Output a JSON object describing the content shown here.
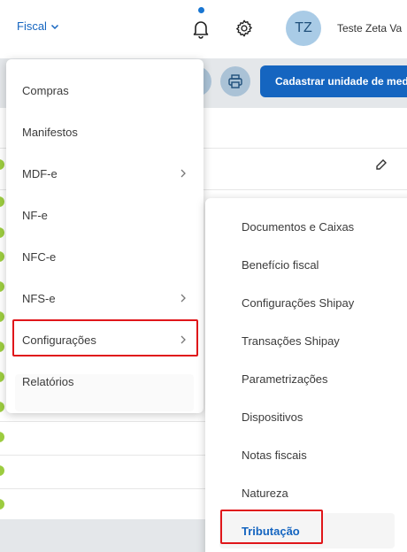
{
  "header": {
    "module_label": "Fiscal",
    "user_initials": "TZ",
    "user_name": "Teste Zeta Va"
  },
  "toolbar": {
    "primary_button_label": "Cadastrar unidade de med"
  },
  "menu": {
    "items": [
      {
        "label": "Compras",
        "has_submenu": false
      },
      {
        "label": "Manifestos",
        "has_submenu": false
      },
      {
        "label": "MDF-e",
        "has_submenu": true
      },
      {
        "label": "NF-e",
        "has_submenu": false
      },
      {
        "label": "NFC-e",
        "has_submenu": false
      },
      {
        "label": "NFS-e",
        "has_submenu": true
      },
      {
        "label": "Configurações",
        "has_submenu": true
      },
      {
        "label": "Relatórios",
        "has_submenu": false
      }
    ],
    "highlighted_item": "Configurações"
  },
  "submenu": {
    "parent": "Configurações",
    "items": [
      {
        "label": "Documentos e Caixas"
      },
      {
        "label": "Benefício fiscal"
      },
      {
        "label": "Configurações Shipay"
      },
      {
        "label": "Transações Shipay"
      },
      {
        "label": "Parametrizações"
      },
      {
        "label": "Dispositivos"
      },
      {
        "label": "Notas fiscais"
      },
      {
        "label": "Natureza"
      },
      {
        "label": "Tributação"
      }
    ],
    "highlighted_item": "Tributação"
  },
  "colors": {
    "accent": "#1565c0",
    "highlight_border": "#e0161a",
    "status_dot": "#9ccc3f"
  }
}
